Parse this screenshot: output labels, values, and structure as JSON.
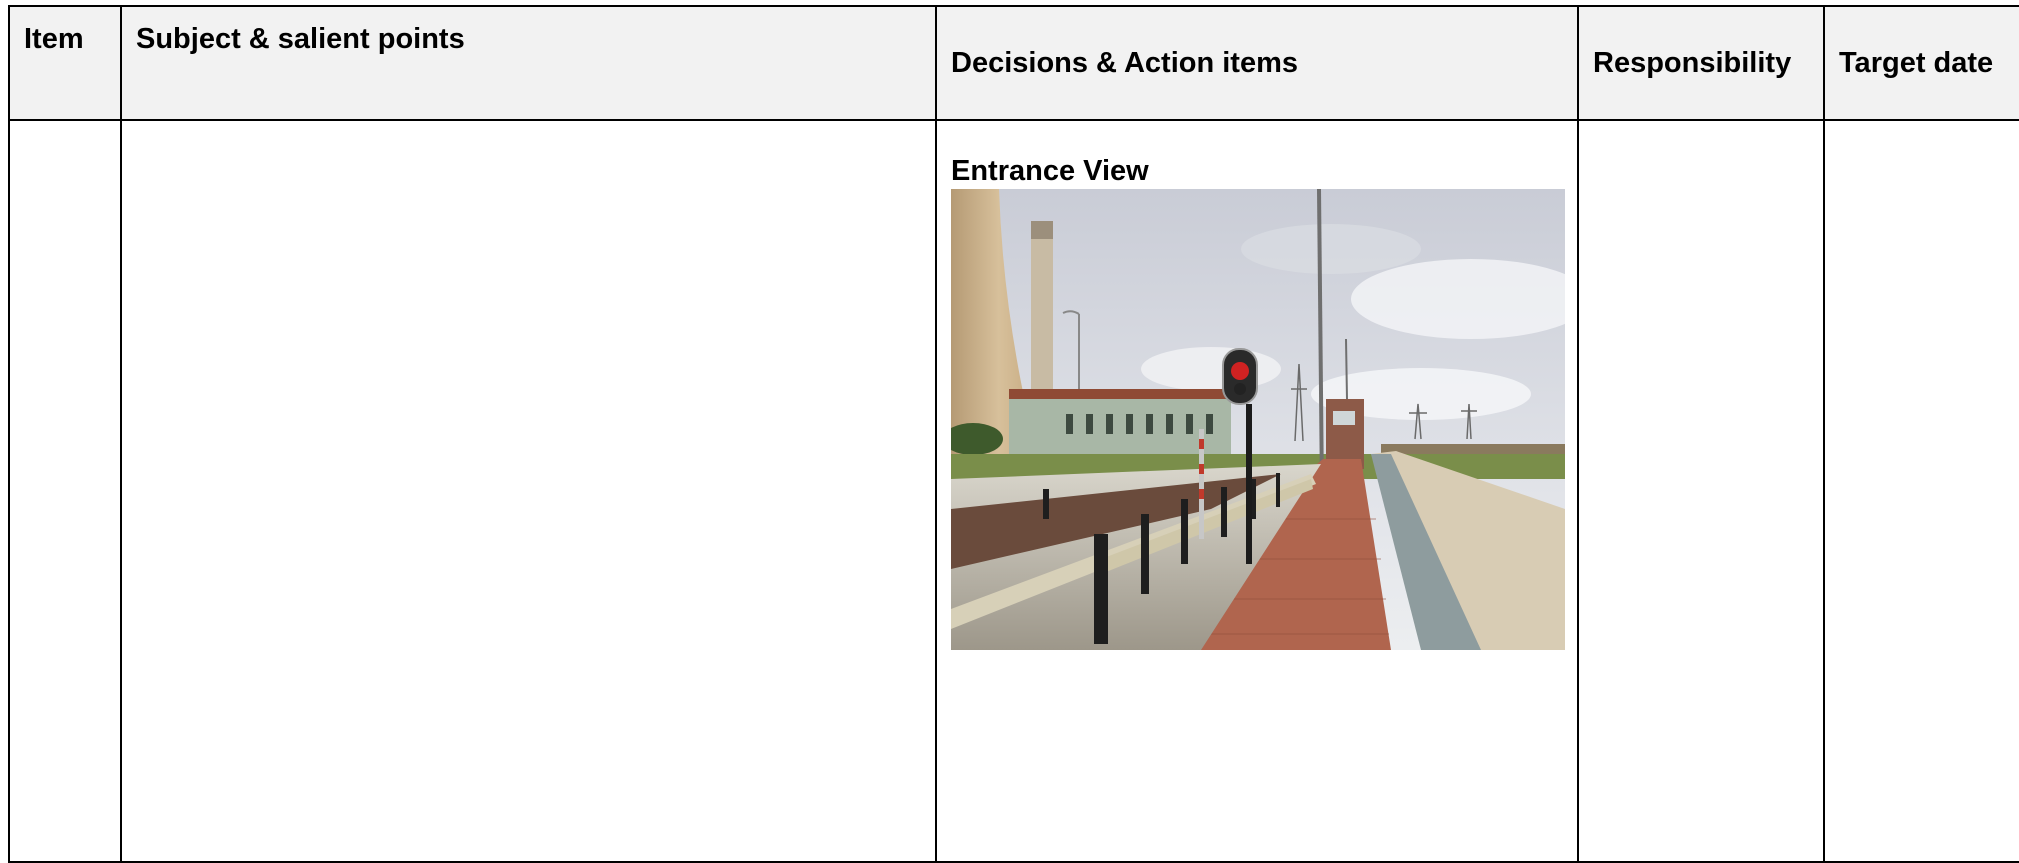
{
  "table": {
    "headers": {
      "item": "Item",
      "subject": "Subject & salient points",
      "decisions": "Decisions & Action items",
      "responsibility": "Responsibility",
      "target_date": "Target date"
    },
    "row": {
      "photo_title": "Entrance View"
    }
  },
  "colors": {
    "header_bg": "#f2f2f2",
    "border": "#000000"
  }
}
